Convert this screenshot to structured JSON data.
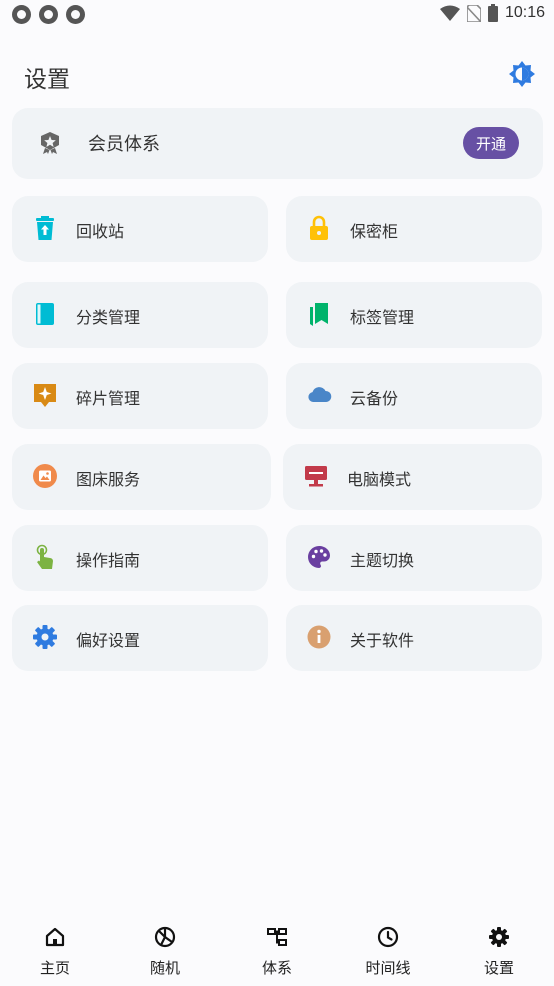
{
  "status_bar": {
    "time": "10:16",
    "left_icons": [
      "notification-icon",
      "notification-icon",
      "notification-icon"
    ],
    "right_icons": [
      "wifi-icon",
      "no-sim-icon",
      "battery-icon"
    ]
  },
  "header": {
    "title": "设置",
    "theme_icon": "brightness-icon"
  },
  "member": {
    "label": "会员体系",
    "icon": "vip-badge-icon",
    "button_label": "开通",
    "button_color": "#6750a4"
  },
  "tiles": [
    {
      "label": "回收站",
      "icon": "recycle-bin-icon",
      "color": "#00bcd4"
    },
    {
      "label": "保密柜",
      "icon": "lock-icon",
      "color": "#ffc107"
    },
    {
      "label": "分类管理",
      "icon": "book-icon",
      "color": "#00bcd4"
    },
    {
      "label": "标签管理",
      "icon": "bookmarks-icon",
      "color": "#00b36b"
    },
    {
      "label": "碎片管理",
      "icon": "sparkle-icon",
      "color": "#d98a15"
    },
    {
      "label": "云备份",
      "icon": "cloud-icon",
      "color": "#4a86c8"
    },
    {
      "label": "图床服务",
      "icon": "image-icon",
      "color": "#f08a4b"
    },
    {
      "label": "电脑模式",
      "icon": "desktop-icon",
      "color": "#c23a4a"
    },
    {
      "label": "操作指南",
      "icon": "touch-icon",
      "color": "#7cb342"
    },
    {
      "label": "主题切换",
      "icon": "palette-icon",
      "color": "#6a3fa0"
    },
    {
      "label": "偏好设置",
      "icon": "settings-icon",
      "color": "#2f7be0"
    },
    {
      "label": "关于软件",
      "icon": "info-icon",
      "color": "#d9a070"
    }
  ],
  "nav": [
    {
      "label": "主页",
      "icon": "home-icon"
    },
    {
      "label": "随机",
      "icon": "random-icon"
    },
    {
      "label": "体系",
      "icon": "hierarchy-icon"
    },
    {
      "label": "时间线",
      "icon": "clock-icon"
    },
    {
      "label": "设置",
      "icon": "settings-icon"
    }
  ]
}
